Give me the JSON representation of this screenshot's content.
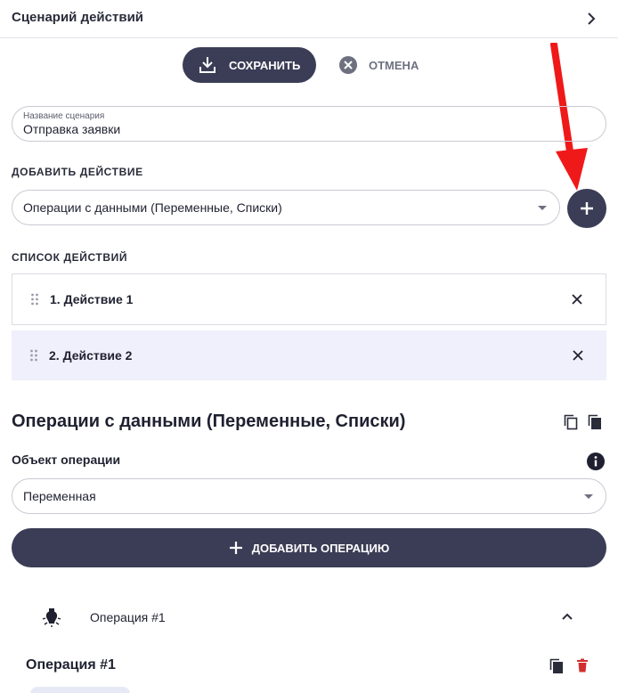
{
  "header": {
    "title": "Сценарий действий"
  },
  "toolbar": {
    "save_label": "СОХРАНИТЬ",
    "cancel_label": "ОТМЕНА"
  },
  "scenario_name": {
    "label": "Название сценария",
    "value": "Отправка заявки"
  },
  "add_action": {
    "section_label": "ДОБАВИТЬ ДЕЙСТВИЕ",
    "selected": "Операции с данными (Переменные, Списки)"
  },
  "actions_list": {
    "section_label": "СПИСОК ДЕЙСТВИЙ",
    "items": [
      {
        "label": "1. Действие 1",
        "selected": false
      },
      {
        "label": "2. Действие 2",
        "selected": true
      }
    ]
  },
  "operation_panel": {
    "title": "Операции с данными (Переменные, Списки)",
    "object_label": "Объект операции",
    "object_value": "Переменная",
    "add_operation_label": "ДОБАВИТЬ ОПЕРАЦИЮ",
    "operation_row_label": "Операция #1",
    "operation_heading": "Операция #1"
  },
  "colors": {
    "primary": "#3a3d55",
    "selected_row": "#eff0fb",
    "annotation_arrow": "#f01919",
    "delete": "#d32f2f"
  }
}
